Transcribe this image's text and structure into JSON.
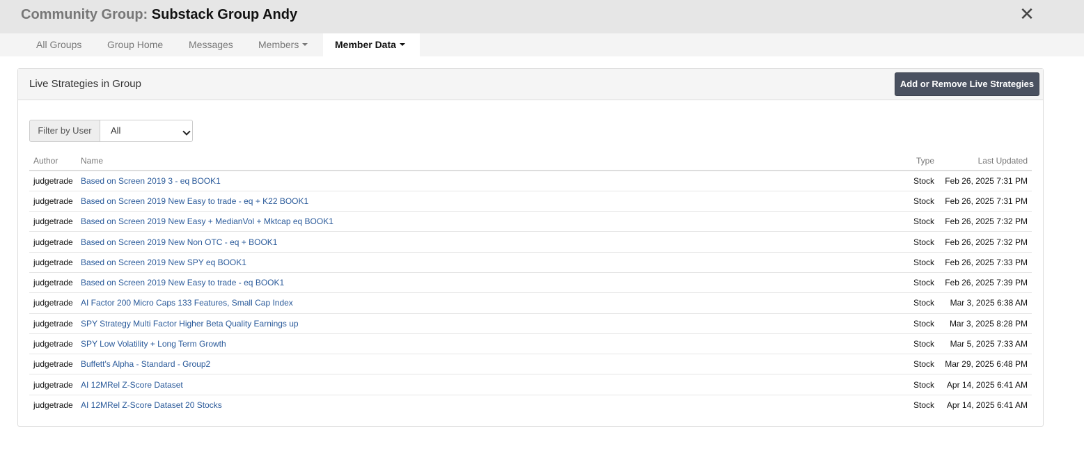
{
  "header": {
    "title_prefix": "Community Group:",
    "title_group": "Substack Group Andy",
    "close_symbol": "✕"
  },
  "tabs": [
    {
      "label": "All Groups"
    },
    {
      "label": "Group Home"
    },
    {
      "label": "Messages"
    },
    {
      "label": "Members"
    },
    {
      "label": "Member Data"
    }
  ],
  "panel": {
    "title": "Live Strategies in Group",
    "add_button": "Add or Remove Live Strategies",
    "filter_label": "Filter by User",
    "filter_value": "All"
  },
  "table": {
    "headers": {
      "author": "Author",
      "name": "Name",
      "type": "Type",
      "updated": "Last Updated"
    },
    "rows": [
      {
        "author": "judgetrade",
        "name": "Based on Screen 2019 3 - eq BOOK1",
        "type": "Stock",
        "updated": "Feb 26, 2025 7:31 PM"
      },
      {
        "author": "judgetrade",
        "name": "Based on Screen 2019 New Easy to trade - eq + K22 BOOK1",
        "type": "Stock",
        "updated": "Feb 26, 2025 7:31 PM"
      },
      {
        "author": "judgetrade",
        "name": "Based on Screen 2019 New Easy + MedianVol + Mktcap eq BOOK1",
        "type": "Stock",
        "updated": "Feb 26, 2025 7:32 PM"
      },
      {
        "author": "judgetrade",
        "name": "Based on Screen 2019 New Non OTC - eq + BOOK1",
        "type": "Stock",
        "updated": "Feb 26, 2025 7:32 PM"
      },
      {
        "author": "judgetrade",
        "name": "Based on Screen 2019 New SPY eq BOOK1",
        "type": "Stock",
        "updated": "Feb 26, 2025 7:33 PM"
      },
      {
        "author": "judgetrade",
        "name": "Based on Screen 2019 New Easy to trade - eq BOOK1",
        "type": "Stock",
        "updated": "Feb 26, 2025 7:39 PM"
      },
      {
        "author": "judgetrade",
        "name": "AI Factor 200 Micro Caps 133 Features, Small Cap Index",
        "type": "Stock",
        "updated": "Mar 3, 2025 6:38 AM"
      },
      {
        "author": "judgetrade",
        "name": "SPY Strategy Multi Factor Higher Beta Quality Earnings up",
        "type": "Stock",
        "updated": "Mar 3, 2025 8:28 PM"
      },
      {
        "author": "judgetrade",
        "name": "SPY Low Volatility + Long Term Growth",
        "type": "Stock",
        "updated": "Mar 5, 2025 7:33 AM"
      },
      {
        "author": "judgetrade",
        "name": "Buffett's Alpha - Standard - Group2",
        "type": "Stock",
        "updated": "Mar 29, 2025 6:48 PM"
      },
      {
        "author": "judgetrade",
        "name": "AI 12MRel Z-Score Dataset",
        "type": "Stock",
        "updated": "Apr 14, 2025 6:41 AM"
      },
      {
        "author": "judgetrade",
        "name": "AI 12MRel Z-Score Dataset 20 Stocks",
        "type": "Stock",
        "updated": "Apr 14, 2025 6:41 AM"
      }
    ]
  }
}
